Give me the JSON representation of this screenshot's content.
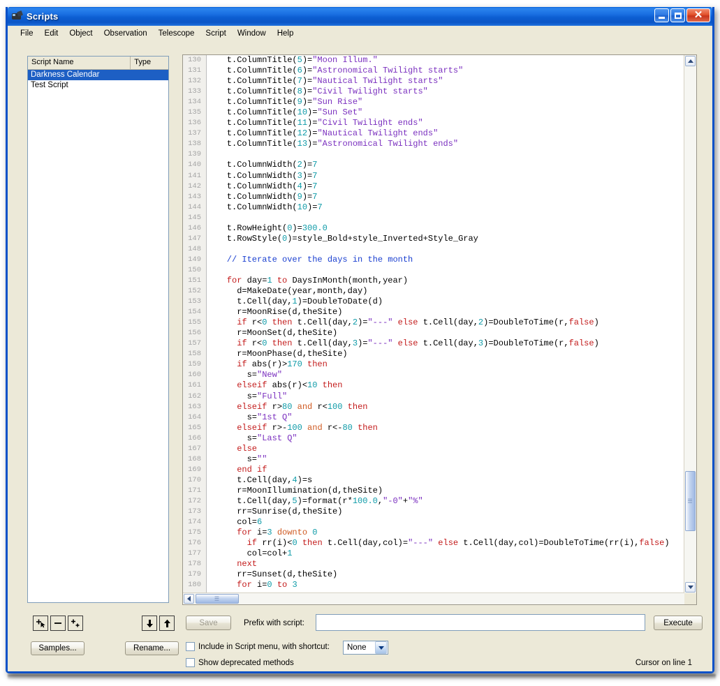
{
  "window": {
    "title": "Scripts",
    "icon": "telescope-icon",
    "buttons": {
      "minimize": "_",
      "maximize": "□",
      "close": "✕"
    }
  },
  "menubar": {
    "items": [
      "File",
      "Edit",
      "Object",
      "Observation",
      "Telescope",
      "Script",
      "Window",
      "Help"
    ]
  },
  "script_list": {
    "columns": [
      "Script Name",
      "Type"
    ],
    "rows": [
      {
        "name": "Darkness Calendar",
        "type": "",
        "selected": true
      },
      {
        "name": "Test Script",
        "type": "",
        "selected": false
      }
    ]
  },
  "list_toolbar": {
    "add": "add-script-button",
    "remove": "remove-script-button",
    "duplicate": "duplicate-script-button",
    "move_down": "move-down-button",
    "move_up": "move-up-button",
    "samples": "Samples...",
    "rename": "Rename..."
  },
  "editor": {
    "first_line": 130,
    "lines": [
      {
        "n": 130,
        "t": [
          [
            "src",
            "    t.ColumnTitle("
          ],
          [
            "num",
            "5"
          ],
          [
            "src",
            ")="
          ],
          [
            "str",
            "\"Moon Illum.\""
          ]
        ]
      },
      {
        "n": 131,
        "t": [
          [
            "src",
            "    t.ColumnTitle("
          ],
          [
            "num",
            "6"
          ],
          [
            "src",
            ")="
          ],
          [
            "str",
            "\"Astronomical Twilight starts\""
          ]
        ]
      },
      {
        "n": 132,
        "t": [
          [
            "src",
            "    t.ColumnTitle("
          ],
          [
            "num",
            "7"
          ],
          [
            "src",
            ")="
          ],
          [
            "str",
            "\"Nautical Twilight starts\""
          ]
        ]
      },
      {
        "n": 133,
        "t": [
          [
            "src",
            "    t.ColumnTitle("
          ],
          [
            "num",
            "8"
          ],
          [
            "src",
            ")="
          ],
          [
            "str",
            "\"Civil Twilight starts\""
          ]
        ]
      },
      {
        "n": 134,
        "t": [
          [
            "src",
            "    t.ColumnTitle("
          ],
          [
            "num",
            "9"
          ],
          [
            "src",
            ")="
          ],
          [
            "str",
            "\"Sun Rise\""
          ]
        ]
      },
      {
        "n": 135,
        "t": [
          [
            "src",
            "    t.ColumnTitle("
          ],
          [
            "num",
            "10"
          ],
          [
            "src",
            ")="
          ],
          [
            "str",
            "\"Sun Set\""
          ]
        ]
      },
      {
        "n": 136,
        "t": [
          [
            "src",
            "    t.ColumnTitle("
          ],
          [
            "num",
            "11"
          ],
          [
            "src",
            ")="
          ],
          [
            "str",
            "\"Civil Twilight ends\""
          ]
        ]
      },
      {
        "n": 137,
        "t": [
          [
            "src",
            "    t.ColumnTitle("
          ],
          [
            "num",
            "12"
          ],
          [
            "src",
            ")="
          ],
          [
            "str",
            "\"Nautical Twilight ends\""
          ]
        ]
      },
      {
        "n": 138,
        "t": [
          [
            "src",
            "    t.ColumnTitle("
          ],
          [
            "num",
            "13"
          ],
          [
            "src",
            ")="
          ],
          [
            "str",
            "\"Astronomical Twilight ends\""
          ]
        ]
      },
      {
        "n": 139,
        "t": []
      },
      {
        "n": 140,
        "t": [
          [
            "src",
            "    t.ColumnWidth("
          ],
          [
            "num",
            "2"
          ],
          [
            "src",
            ")="
          ],
          [
            "num",
            "7"
          ]
        ]
      },
      {
        "n": 141,
        "t": [
          [
            "src",
            "    t.ColumnWidth("
          ],
          [
            "num",
            "3"
          ],
          [
            "src",
            ")="
          ],
          [
            "num",
            "7"
          ]
        ]
      },
      {
        "n": 142,
        "t": [
          [
            "src",
            "    t.ColumnWidth("
          ],
          [
            "num",
            "4"
          ],
          [
            "src",
            ")="
          ],
          [
            "num",
            "7"
          ]
        ]
      },
      {
        "n": 143,
        "t": [
          [
            "src",
            "    t.ColumnWidth("
          ],
          [
            "num",
            "9"
          ],
          [
            "src",
            ")="
          ],
          [
            "num",
            "7"
          ]
        ]
      },
      {
        "n": 144,
        "t": [
          [
            "src",
            "    t.ColumnWidth("
          ],
          [
            "num",
            "10"
          ],
          [
            "src",
            ")="
          ],
          [
            "num",
            "7"
          ]
        ]
      },
      {
        "n": 145,
        "t": []
      },
      {
        "n": 146,
        "t": [
          [
            "src",
            "    t.RowHeight("
          ],
          [
            "num",
            "0"
          ],
          [
            "src",
            ")="
          ],
          [
            "num",
            "300.0"
          ]
        ]
      },
      {
        "n": 147,
        "t": [
          [
            "src",
            "    t.RowStyle("
          ],
          [
            "num",
            "0"
          ],
          [
            "src",
            ")=style_Bold+style_Inverted+Style_Gray"
          ]
        ]
      },
      {
        "n": 148,
        "t": []
      },
      {
        "n": 149,
        "t": [
          [
            "com",
            "    // Iterate over the days in the month"
          ]
        ]
      },
      {
        "n": 150,
        "t": []
      },
      {
        "n": 151,
        "t": [
          [
            "kw",
            "    for"
          ],
          [
            "src",
            " day="
          ],
          [
            "num",
            "1"
          ],
          [
            "kw",
            " to"
          ],
          [
            "src",
            " DaysInMonth(month,year)"
          ]
        ]
      },
      {
        "n": 152,
        "t": [
          [
            "src",
            "      d=MakeDate(year,month,day)"
          ]
        ]
      },
      {
        "n": 153,
        "t": [
          [
            "src",
            "      t.Cell(day,"
          ],
          [
            "num",
            "1"
          ],
          [
            "src",
            ")=DoubleToDate(d)"
          ]
        ]
      },
      {
        "n": 154,
        "t": [
          [
            "src",
            "      r=MoonRise(d,theSite)"
          ]
        ]
      },
      {
        "n": 155,
        "t": [
          [
            "kw",
            "      if"
          ],
          [
            "src",
            " r<"
          ],
          [
            "num",
            "0"
          ],
          [
            "kw",
            " then"
          ],
          [
            "src",
            " t.Cell(day,"
          ],
          [
            "num",
            "2"
          ],
          [
            "src",
            ")="
          ],
          [
            "str",
            "\"---\""
          ],
          [
            "kw",
            " else"
          ],
          [
            "src",
            " t.Cell(day,"
          ],
          [
            "num",
            "2"
          ],
          [
            "src",
            ")=DoubleToTime(r,"
          ],
          [
            "kw",
            "false"
          ],
          [
            "src",
            ")"
          ]
        ]
      },
      {
        "n": 156,
        "t": [
          [
            "src",
            "      r=MoonSet(d,theSite)"
          ]
        ]
      },
      {
        "n": 157,
        "t": [
          [
            "kw",
            "      if"
          ],
          [
            "src",
            " r<"
          ],
          [
            "num",
            "0"
          ],
          [
            "kw",
            " then"
          ],
          [
            "src",
            " t.Cell(day,"
          ],
          [
            "num",
            "3"
          ],
          [
            "src",
            ")="
          ],
          [
            "str",
            "\"---\""
          ],
          [
            "kw",
            " else"
          ],
          [
            "src",
            " t.Cell(day,"
          ],
          [
            "num",
            "3"
          ],
          [
            "src",
            ")=DoubleToTime(r,"
          ],
          [
            "kw",
            "false"
          ],
          [
            "src",
            ")"
          ]
        ]
      },
      {
        "n": 158,
        "t": [
          [
            "src",
            "      r=MoonPhase(d,theSite)"
          ]
        ]
      },
      {
        "n": 159,
        "t": [
          [
            "kw",
            "      if"
          ],
          [
            "src",
            " abs(r)>"
          ],
          [
            "num",
            "170"
          ],
          [
            "kw",
            " then"
          ]
        ]
      },
      {
        "n": 160,
        "t": [
          [
            "src",
            "        s="
          ],
          [
            "str",
            "\"New\""
          ]
        ]
      },
      {
        "n": 161,
        "t": [
          [
            "kw",
            "      elseif"
          ],
          [
            "src",
            " abs(r)<"
          ],
          [
            "num",
            "10"
          ],
          [
            "kw",
            " then"
          ]
        ]
      },
      {
        "n": 162,
        "t": [
          [
            "src",
            "        s="
          ],
          [
            "str",
            "\"Full\""
          ]
        ]
      },
      {
        "n": 163,
        "t": [
          [
            "kw",
            "      elseif"
          ],
          [
            "src",
            " r>"
          ],
          [
            "num",
            "80"
          ],
          [
            "kw2",
            " and"
          ],
          [
            "src",
            " r<"
          ],
          [
            "num",
            "100"
          ],
          [
            "kw",
            " then"
          ]
        ]
      },
      {
        "n": 164,
        "t": [
          [
            "src",
            "        s="
          ],
          [
            "str",
            "\"1st Q\""
          ]
        ]
      },
      {
        "n": 165,
        "t": [
          [
            "kw",
            "      elseif"
          ],
          [
            "src",
            " r>-"
          ],
          [
            "num",
            "100"
          ],
          [
            "kw2",
            " and"
          ],
          [
            "src",
            " r<-"
          ],
          [
            "num",
            "80"
          ],
          [
            "kw",
            " then"
          ]
        ]
      },
      {
        "n": 166,
        "t": [
          [
            "src",
            "        s="
          ],
          [
            "str",
            "\"Last Q\""
          ]
        ]
      },
      {
        "n": 167,
        "t": [
          [
            "kw",
            "      else"
          ]
        ]
      },
      {
        "n": 168,
        "t": [
          [
            "src",
            "        s="
          ],
          [
            "str",
            "\"\""
          ]
        ]
      },
      {
        "n": 169,
        "t": [
          [
            "kw",
            "      end if"
          ]
        ]
      },
      {
        "n": 170,
        "t": [
          [
            "src",
            "      t.Cell(day,"
          ],
          [
            "num",
            "4"
          ],
          [
            "src",
            ")=s"
          ]
        ]
      },
      {
        "n": 171,
        "t": [
          [
            "src",
            "      r=MoonIllumination(d,theSite)"
          ]
        ]
      },
      {
        "n": 172,
        "t": [
          [
            "src",
            "      t.Cell(day,"
          ],
          [
            "num",
            "5"
          ],
          [
            "src",
            ")=format(r*"
          ],
          [
            "num",
            "100.0"
          ],
          [
            "src",
            ","
          ],
          [
            "str",
            "\"-0\""
          ],
          [
            "src",
            "+"
          ],
          [
            "str",
            "\"%\""
          ]
        ]
      },
      {
        "n": 173,
        "t": [
          [
            "src",
            "      rr=Sunrise(d,theSite)"
          ]
        ]
      },
      {
        "n": 174,
        "t": [
          [
            "src",
            "      col="
          ],
          [
            "num",
            "6"
          ]
        ]
      },
      {
        "n": 175,
        "t": [
          [
            "kw",
            "      for"
          ],
          [
            "src",
            " i="
          ],
          [
            "num",
            "3"
          ],
          [
            "kw2",
            " downto"
          ],
          [
            "src",
            " "
          ],
          [
            "num",
            "0"
          ]
        ]
      },
      {
        "n": 176,
        "t": [
          [
            "kw",
            "        if"
          ],
          [
            "src",
            " rr(i)<"
          ],
          [
            "num",
            "0"
          ],
          [
            "kw",
            " then"
          ],
          [
            "src",
            " t.Cell(day,col)="
          ],
          [
            "str",
            "\"---\""
          ],
          [
            "kw",
            " else"
          ],
          [
            "src",
            " t.Cell(day,col)=DoubleToTime(rr(i),"
          ],
          [
            "kw",
            "false"
          ],
          [
            "src",
            ")"
          ]
        ]
      },
      {
        "n": 177,
        "t": [
          [
            "src",
            "        col=col+"
          ],
          [
            "num",
            "1"
          ]
        ]
      },
      {
        "n": 178,
        "t": [
          [
            "kw",
            "      next"
          ]
        ]
      },
      {
        "n": 179,
        "t": [
          [
            "src",
            "      rr=Sunset(d,theSite)"
          ]
        ]
      },
      {
        "n": 180,
        "t": [
          [
            "kw",
            "      for"
          ],
          [
            "src",
            " i="
          ],
          [
            "num",
            "0"
          ],
          [
            "kw",
            " to"
          ],
          [
            "src",
            " "
          ],
          [
            "num",
            "3"
          ]
        ]
      }
    ],
    "colors": {
      "string": "#7a2fbf",
      "number": "#0f9ba8",
      "keyword": "#c31b1b",
      "keyword_alt": "#cf5a22",
      "comment": "#1a3fd0",
      "plain": "#000000",
      "gutter": "#a5a5a5"
    }
  },
  "bottom": {
    "save_label": "Save",
    "save_enabled": false,
    "prefix_label": "Prefix with script:",
    "prefix_value": "",
    "prefix_placeholder": "",
    "execute_label": "Execute",
    "include_label": "Include in Script menu, with shortcut:",
    "include_checked": false,
    "shortcut_value": "None",
    "shortcut_options": [
      "None"
    ],
    "deprecated_label": "Show deprecated methods",
    "deprecated_checked": false,
    "status": "Cursor on line 1"
  }
}
